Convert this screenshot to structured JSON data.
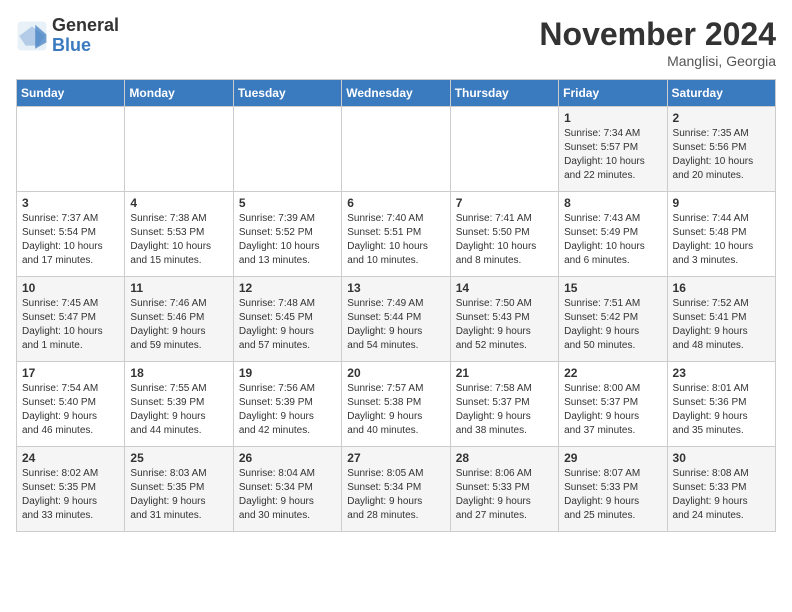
{
  "header": {
    "logo_general": "General",
    "logo_blue": "Blue",
    "month_title": "November 2024",
    "location": "Manglisi, Georgia"
  },
  "days_of_week": [
    "Sunday",
    "Monday",
    "Tuesday",
    "Wednesday",
    "Thursday",
    "Friday",
    "Saturday"
  ],
  "weeks": [
    {
      "days": [
        {
          "num": "",
          "info": ""
        },
        {
          "num": "",
          "info": ""
        },
        {
          "num": "",
          "info": ""
        },
        {
          "num": "",
          "info": ""
        },
        {
          "num": "",
          "info": ""
        },
        {
          "num": "1",
          "info": "Sunrise: 7:34 AM\nSunset: 5:57 PM\nDaylight: 10 hours\nand 22 minutes."
        },
        {
          "num": "2",
          "info": "Sunrise: 7:35 AM\nSunset: 5:56 PM\nDaylight: 10 hours\nand 20 minutes."
        }
      ]
    },
    {
      "days": [
        {
          "num": "3",
          "info": "Sunrise: 7:37 AM\nSunset: 5:54 PM\nDaylight: 10 hours\nand 17 minutes."
        },
        {
          "num": "4",
          "info": "Sunrise: 7:38 AM\nSunset: 5:53 PM\nDaylight: 10 hours\nand 15 minutes."
        },
        {
          "num": "5",
          "info": "Sunrise: 7:39 AM\nSunset: 5:52 PM\nDaylight: 10 hours\nand 13 minutes."
        },
        {
          "num": "6",
          "info": "Sunrise: 7:40 AM\nSunset: 5:51 PM\nDaylight: 10 hours\nand 10 minutes."
        },
        {
          "num": "7",
          "info": "Sunrise: 7:41 AM\nSunset: 5:50 PM\nDaylight: 10 hours\nand 8 minutes."
        },
        {
          "num": "8",
          "info": "Sunrise: 7:43 AM\nSunset: 5:49 PM\nDaylight: 10 hours\nand 6 minutes."
        },
        {
          "num": "9",
          "info": "Sunrise: 7:44 AM\nSunset: 5:48 PM\nDaylight: 10 hours\nand 3 minutes."
        }
      ]
    },
    {
      "days": [
        {
          "num": "10",
          "info": "Sunrise: 7:45 AM\nSunset: 5:47 PM\nDaylight: 10 hours\nand 1 minute."
        },
        {
          "num": "11",
          "info": "Sunrise: 7:46 AM\nSunset: 5:46 PM\nDaylight: 9 hours\nand 59 minutes."
        },
        {
          "num": "12",
          "info": "Sunrise: 7:48 AM\nSunset: 5:45 PM\nDaylight: 9 hours\nand 57 minutes."
        },
        {
          "num": "13",
          "info": "Sunrise: 7:49 AM\nSunset: 5:44 PM\nDaylight: 9 hours\nand 54 minutes."
        },
        {
          "num": "14",
          "info": "Sunrise: 7:50 AM\nSunset: 5:43 PM\nDaylight: 9 hours\nand 52 minutes."
        },
        {
          "num": "15",
          "info": "Sunrise: 7:51 AM\nSunset: 5:42 PM\nDaylight: 9 hours\nand 50 minutes."
        },
        {
          "num": "16",
          "info": "Sunrise: 7:52 AM\nSunset: 5:41 PM\nDaylight: 9 hours\nand 48 minutes."
        }
      ]
    },
    {
      "days": [
        {
          "num": "17",
          "info": "Sunrise: 7:54 AM\nSunset: 5:40 PM\nDaylight: 9 hours\nand 46 minutes."
        },
        {
          "num": "18",
          "info": "Sunrise: 7:55 AM\nSunset: 5:39 PM\nDaylight: 9 hours\nand 44 minutes."
        },
        {
          "num": "19",
          "info": "Sunrise: 7:56 AM\nSunset: 5:39 PM\nDaylight: 9 hours\nand 42 minutes."
        },
        {
          "num": "20",
          "info": "Sunrise: 7:57 AM\nSunset: 5:38 PM\nDaylight: 9 hours\nand 40 minutes."
        },
        {
          "num": "21",
          "info": "Sunrise: 7:58 AM\nSunset: 5:37 PM\nDaylight: 9 hours\nand 38 minutes."
        },
        {
          "num": "22",
          "info": "Sunrise: 8:00 AM\nSunset: 5:37 PM\nDaylight: 9 hours\nand 37 minutes."
        },
        {
          "num": "23",
          "info": "Sunrise: 8:01 AM\nSunset: 5:36 PM\nDaylight: 9 hours\nand 35 minutes."
        }
      ]
    },
    {
      "days": [
        {
          "num": "24",
          "info": "Sunrise: 8:02 AM\nSunset: 5:35 PM\nDaylight: 9 hours\nand 33 minutes."
        },
        {
          "num": "25",
          "info": "Sunrise: 8:03 AM\nSunset: 5:35 PM\nDaylight: 9 hours\nand 31 minutes."
        },
        {
          "num": "26",
          "info": "Sunrise: 8:04 AM\nSunset: 5:34 PM\nDaylight: 9 hours\nand 30 minutes."
        },
        {
          "num": "27",
          "info": "Sunrise: 8:05 AM\nSunset: 5:34 PM\nDaylight: 9 hours\nand 28 minutes."
        },
        {
          "num": "28",
          "info": "Sunrise: 8:06 AM\nSunset: 5:33 PM\nDaylight: 9 hours\nand 27 minutes."
        },
        {
          "num": "29",
          "info": "Sunrise: 8:07 AM\nSunset: 5:33 PM\nDaylight: 9 hours\nand 25 minutes."
        },
        {
          "num": "30",
          "info": "Sunrise: 8:08 AM\nSunset: 5:33 PM\nDaylight: 9 hours\nand 24 minutes."
        }
      ]
    }
  ]
}
